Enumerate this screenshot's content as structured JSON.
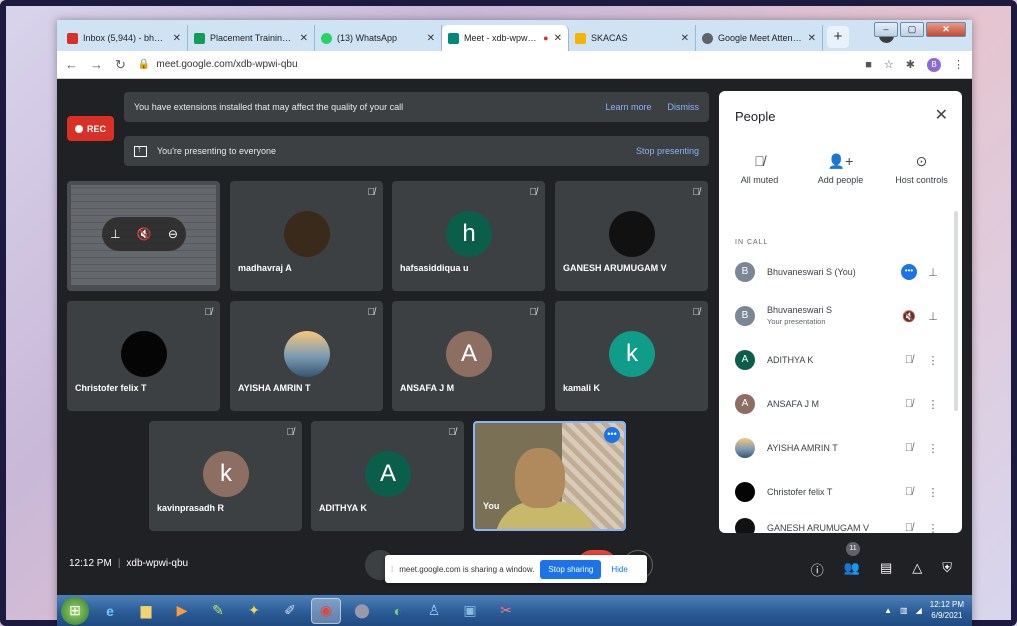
{
  "browser": {
    "tabs": [
      {
        "label": "Inbox (5,944) - bhuvan...",
        "color": "#d93025"
      },
      {
        "label": "Placement Training Att...",
        "color": "#0f9d58"
      },
      {
        "label": "(13) WhatsApp",
        "color": "#25d366"
      },
      {
        "label": "Meet - xdb-wpwi-...",
        "color": "#00897b"
      },
      {
        "label": "SKACAS",
        "color": "#f4b400"
      },
      {
        "label": "Google Meet Attendan...",
        "color": "#5f6368"
      }
    ],
    "new_tab": "+",
    "url": "meet.google.com/xdb-wpwi-qbu",
    "account_initial": "B"
  },
  "meet": {
    "rec_label": "REC",
    "ext_banner": {
      "message": "You have extensions installed that may affect the quality of your call",
      "learn_more": "Learn more",
      "dismiss": "Dismiss"
    },
    "present_banner": {
      "message": "You're presenting to everyone",
      "stop": "Stop presenting"
    },
    "tiles": [
      {
        "name": "madhavraj A",
        "initial": "",
        "color": "#3a2a1c"
      },
      {
        "name": "hafsasiddiqua u",
        "initial": "h",
        "color": "#0b5e4a"
      },
      {
        "name": "GANESH ARUMUGAM V",
        "initial": "",
        "color": "#111111"
      },
      {
        "name": "Christofer felix T",
        "initial": "",
        "color": "#050505"
      },
      {
        "name": "AYISHA AMRIN T",
        "initial": "",
        "color": "#7d9bb3"
      },
      {
        "name": "ANSAFA J M",
        "initial": "A",
        "color": "#8d6e63"
      },
      {
        "name": "kamali K",
        "initial": "k",
        "color": "#0f9d8a"
      },
      {
        "name": "kavinprasadh R",
        "initial": "k",
        "color": "#8d6e63"
      },
      {
        "name": "ADITHYA K",
        "initial": "A",
        "color": "#0b5e4a"
      }
    ],
    "you_tile": {
      "name": "You"
    },
    "meeting_time": "12:12 PM",
    "meeting_code": "xdb-wpwi-qbu",
    "share_bar": {
      "message": "meet.google.com is sharing a window.",
      "stop": "Stop sharing",
      "hide": "Hide"
    },
    "participant_count": "11"
  },
  "people_panel": {
    "title": "People",
    "actions": [
      {
        "label": "All muted",
        "icon": "mic-off-icon"
      },
      {
        "label": "Add people",
        "icon": "add-person-icon"
      },
      {
        "label": "Host controls",
        "icon": "toggle-icon"
      }
    ],
    "section": "IN CALL",
    "participants": [
      {
        "name": "Bhuvaneswari S (You)",
        "sub": "",
        "initial": "B",
        "color": "#7b8794"
      },
      {
        "name": "Bhuvaneswari S",
        "sub": "Your presentation",
        "initial": "B",
        "color": "#7b8794"
      },
      {
        "name": "ADITHYA K",
        "sub": "",
        "initial": "A",
        "color": "#0b5e4a"
      },
      {
        "name": "ANSAFA J M",
        "sub": "",
        "initial": "A",
        "color": "#8d6e63"
      },
      {
        "name": "AYISHA AMRIN T",
        "sub": "",
        "initial": "",
        "color": "#7d9bb3"
      },
      {
        "name": "Christofer felix T",
        "sub": "",
        "initial": "",
        "color": "#050505"
      },
      {
        "name": "GANESH ARUMUGAM V",
        "sub": "",
        "initial": "",
        "color": "#111111"
      }
    ]
  },
  "taskbar": {
    "time": "12:12 PM",
    "date": "6/9/2021"
  }
}
